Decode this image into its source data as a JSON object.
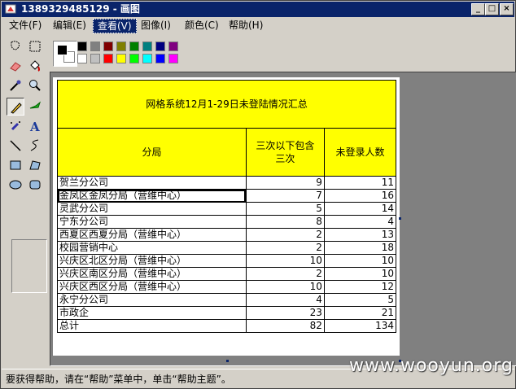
{
  "title": "1389329485129 - 画图",
  "window_controls": {
    "minimize": "_",
    "maximize": "□",
    "close": "×"
  },
  "menu": [
    {
      "label": "文件(F)"
    },
    {
      "label": "编辑(E)"
    },
    {
      "label": "查看(V)"
    },
    {
      "label": "图像(I)"
    },
    {
      "label": "颜色(C)"
    },
    {
      "label": "帮助(H)"
    }
  ],
  "palette_colors": [
    "#000000",
    "#808080",
    "#800000",
    "#808000",
    "#008000",
    "#008080",
    "#000080",
    "#800080",
    "#ffffff",
    "#c0c0c0",
    "#ff0000",
    "#ffff00",
    "#00ff00",
    "#00ffff",
    "#0000ff",
    "#ff00ff"
  ],
  "tools": [
    "free-select-icon",
    "rect-select-icon",
    "eraser-icon",
    "fill-icon",
    "color-picker-icon",
    "magnifier-icon",
    "pencil-icon",
    "brush-icon",
    "airbrush-icon",
    "text-icon",
    "line-icon",
    "curve-icon",
    "rectangle-icon",
    "polygon-icon",
    "ellipse-icon",
    "rounded-rect-icon"
  ],
  "sheet": {
    "title": "网格系统12月1-29日未登陆情况汇总",
    "headers": {
      "col1": "分局",
      "col2": "三次以下包含三次",
      "col3": "未登录人数"
    },
    "rows": [
      {
        "name": "贺兰分公司",
        "a": "9",
        "b": "11"
      },
      {
        "name": "金凤区金凤分局（营维中心）",
        "a": "7",
        "b": "16"
      },
      {
        "name": "灵武分公司",
        "a": "5",
        "b": "14"
      },
      {
        "name": "宁东分公司",
        "a": "8",
        "b": "4"
      },
      {
        "name": "西夏区西夏分局（营维中心）",
        "a": "2",
        "b": "13"
      },
      {
        "name": "校园营销中心",
        "a": "2",
        "b": "18"
      },
      {
        "name": "兴庆区北区分局（营维中心）",
        "a": "10",
        "b": "10"
      },
      {
        "name": "兴庆区南区分局（营维中心）",
        "a": "2",
        "b": "10"
      },
      {
        "name": "兴庆区西区分局（营维中心）",
        "a": "10",
        "b": "12"
      },
      {
        "name": "永宁分公司",
        "a": "4",
        "b": "5"
      },
      {
        "name": "市政企",
        "a": "23",
        "b": "21"
      },
      {
        "name": "总计",
        "a": "82",
        "b": "134"
      }
    ]
  },
  "status": "要获得帮助，请在“帮助”菜单中，单击“帮助主题”。",
  "watermark": "www.wooyun.org"
}
